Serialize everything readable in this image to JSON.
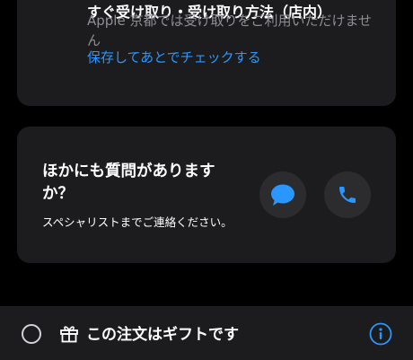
{
  "pickup_card": {
    "title": "すぐ受け取り・受け取り方法（店内）",
    "description": "Apple 京都では受け取りをご利用いただけません",
    "save_link": "保存してあとでチェックする"
  },
  "help_card": {
    "heading": "ほかにも質問がありますか？",
    "subtext": "スペシャリストまでご連絡ください。",
    "chat_icon": "chat-bubble-icon",
    "phone_icon": "phone-icon"
  },
  "gift_option": {
    "label": "この注文はギフトです",
    "icon": "gift-icon",
    "info_icon": "info-icon",
    "checked": false
  },
  "colors": {
    "background": "#000000",
    "card": "#1c1c1e",
    "secondary_text": "#8e8e93",
    "accent": "#2997ff"
  }
}
